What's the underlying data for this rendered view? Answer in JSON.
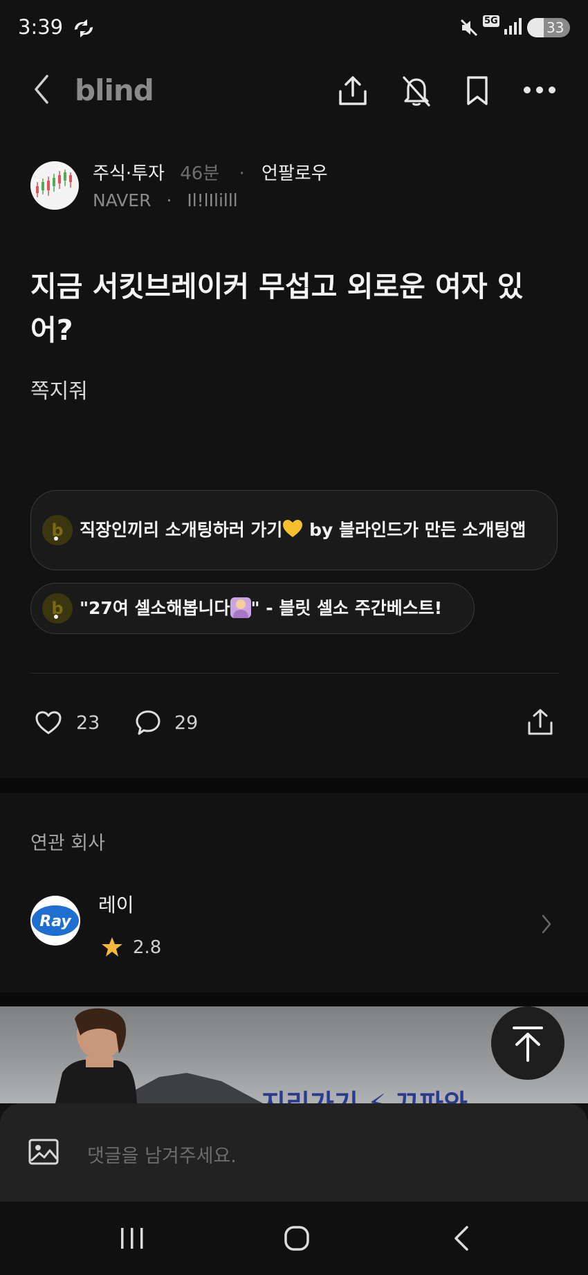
{
  "status": {
    "time": "3:39",
    "battery": "33",
    "network": "5G"
  },
  "topbar": {
    "brand": "blind"
  },
  "post": {
    "category": "주식·투자",
    "time_ago": "46분",
    "unfollow_label": "언팔로우",
    "company": "NAVER",
    "nickname": "Il!lIlilll",
    "title": "지금 서킷브레이커 무섭고 외로운 여자 있어?",
    "body": "쪽지줘",
    "likes": "23",
    "comments": "29"
  },
  "promos": [
    {
      "text_before": "직장인끼리 소개팅하러 가기",
      "text_after": " by 블라인드가 만든 소개팅앱",
      "icon_letter": "b"
    },
    {
      "text_before": "\"27여 셀소해봅니다",
      "text_after": "\" - 블릿 셀소 주간베스트!",
      "icon_letter": "b"
    }
  ],
  "related": {
    "section_label": "연관 회사",
    "company_name": "레이",
    "company_logo_text": "Ray",
    "rating": "2.8"
  },
  "banner": {
    "text": "지리가기 ⚡ 끄파와"
  },
  "comment": {
    "placeholder": "댓글을 남겨주세요."
  },
  "colors": {
    "background": "#121212",
    "accent_star": "#f5b83a",
    "promo_icon": "#3b3510"
  }
}
